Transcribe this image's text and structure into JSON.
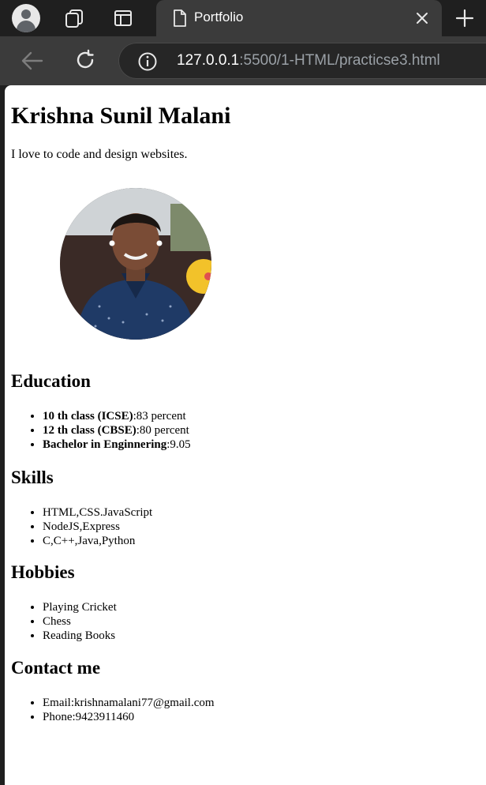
{
  "browser": {
    "tab_title": "Portfolio",
    "url_host": "127.0.0.1",
    "url_rest": ":5500/1-HTML/practicse3.html",
    "icons": {
      "profile": "profile-icon",
      "collections": "collections-icon",
      "tab_actions": "tab-actions-icon",
      "tab_doc": "document-icon",
      "close": "close-icon",
      "new_tab": "plus-icon",
      "back": "back-arrow-icon",
      "reload": "reload-icon",
      "info": "info-icon"
    }
  },
  "page": {
    "name": "Krishna Sunil Malani",
    "tagline": "I love to code and design websites.",
    "education": {
      "heading": "Education",
      "items": [
        {
          "label": "10 th class (ICSE)",
          "value": ":83 percent"
        },
        {
          "label": "12 th class (CBSE)",
          "value": ":80 percent"
        },
        {
          "label": "Bachelor in Enginnering",
          "value": ":9.05"
        }
      ]
    },
    "skills": {
      "heading": "Skills",
      "items": [
        "HTML,CSS.JavaScript",
        "NodeJS,Express",
        "C,C++,Java,Python"
      ]
    },
    "hobbies": {
      "heading": "Hobbies",
      "items": [
        "Playing Cricket",
        "Chess",
        "Reading Books"
      ]
    },
    "contact": {
      "heading": "Contact me",
      "items": [
        "Email:krishnamalani77@gmail.com",
        "Phone:9423911460"
      ]
    }
  }
}
